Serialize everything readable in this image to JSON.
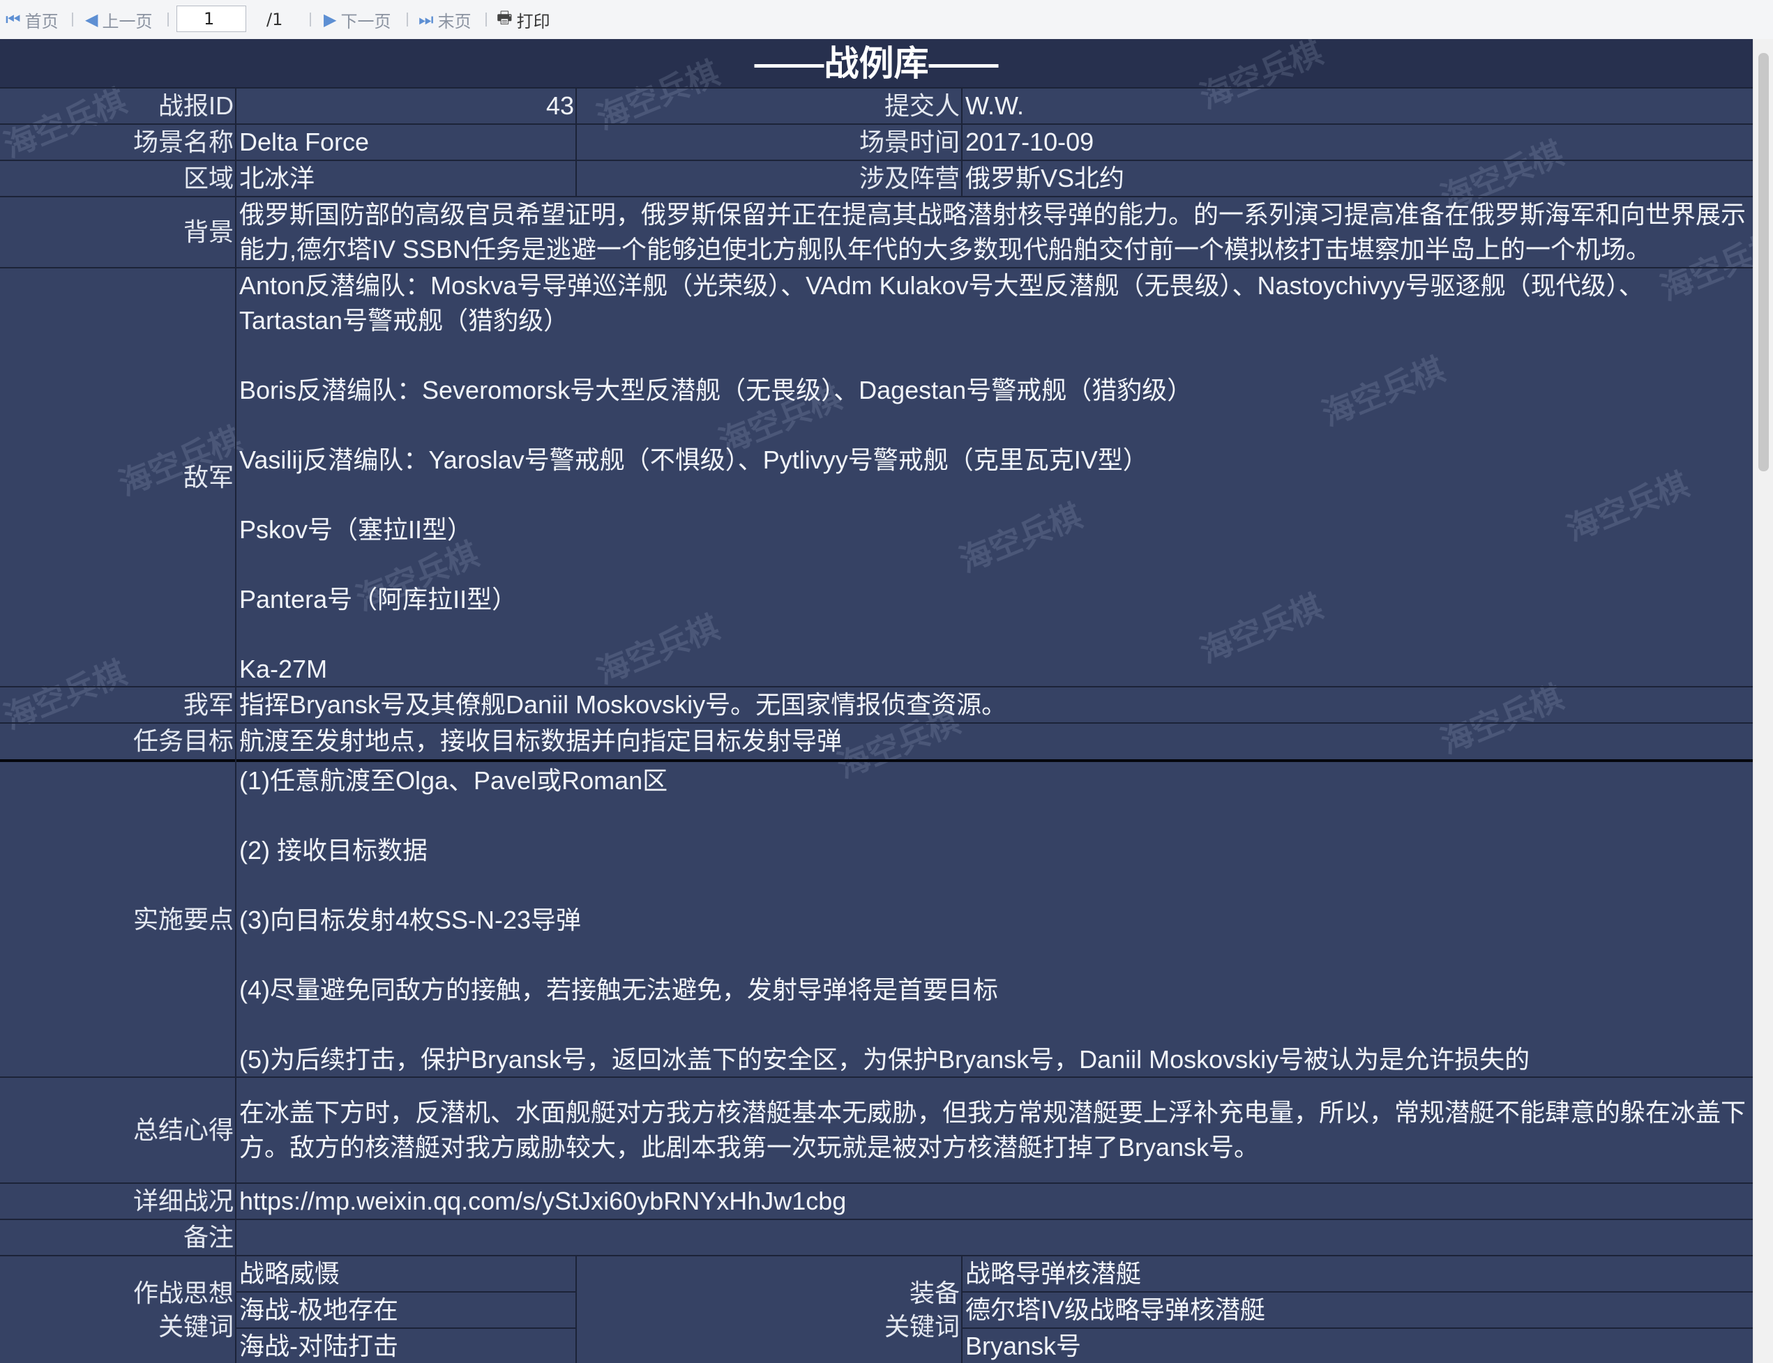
{
  "toolbar": {
    "first": "首页",
    "prev": "上一页",
    "page_value": "1",
    "page_total": "/1",
    "next": "下一页",
    "last": "末页",
    "print": "打印"
  },
  "report": {
    "title": "——战例库——",
    "labels": {
      "id": "战报ID",
      "submitter": "提交人",
      "scene_name": "场景名称",
      "scene_time": "场景时间",
      "region": "区域",
      "camps": "涉及阵营",
      "background": "背景",
      "enemy": "敌军",
      "friendly": "我军",
      "objective": "任务目标",
      "key_points": "实施要点",
      "summary": "总结心得",
      "detail": "详细战况",
      "remarks": "备注",
      "doctrine_1": "作战思想",
      "doctrine_2": "关键词",
      "equipment_1": "装备",
      "equipment_2": "关键词"
    },
    "values": {
      "id": "43",
      "submitter": "W.W.",
      "scene_name": "Delta Force",
      "scene_time": "2017-10-09",
      "region": "北冰洋",
      "camps": "俄罗斯VS北约",
      "background": "俄罗斯国防部的高级官员希望证明，俄罗斯保留并正在提高其战略潜射核导弹的能力。的一系列演习提高准备在俄罗斯海军和向世界展示能力,德尔塔IV SSBN任务是逃避一个能够迫使北方舰队年代的大多数现代船舶交付前一个模拟核打击堪察加半岛上的一个机场。",
      "enemy": [
        "Anton反潜编队：Moskva号导弹巡洋舰（光荣级）、VAdm Kulakov号大型反潜舰（无畏级）、Nastoychivyy号驱逐舰（现代级）、Tartastan号警戒舰（猎豹级）",
        "",
        "Boris反潜编队：Severomorsk号大型反潜舰（无畏级）、Dagestan号警戒舰（猎豹级）",
        "",
        "Vasilij反潜编队：Yaroslav号警戒舰（不惧级）、Pytlivyy号警戒舰（克里瓦克IV型）",
        "",
        "Pskov号（塞拉II型）",
        "",
        "Pantera号（阿库拉II型）",
        "",
        "Ka-27M"
      ],
      "friendly": "指挥Bryansk号及其僚舰Daniil Moskovskiy号。无国家情报侦查资源。",
      "objective": "航渡至发射地点，接收目标数据并向指定目标发射导弹",
      "key_points": [
        "(1)任意航渡至Olga、Pavel或Roman区",
        "",
        "(2) 接收目标数据",
        "",
        "(3)向目标发射4枚SS-N-23导弹",
        "",
        "(4)尽量避免同敌方的接触，若接触无法避免，发射导弹将是首要目标",
        "",
        "(5)为后续打击，保护Bryansk号，返回冰盖下的安全区，为保护Bryansk号，Daniil Moskovskiy号被认为是允许损失的"
      ],
      "summary": "在冰盖下方时，反潜机、水面舰艇对方我方核潜艇基本无威胁，但我方常规潜艇要上浮补充电量，所以，常规潜艇不能肆意的躲在冰盖下方。敌方的核潜艇对我方威胁较大，此剧本我第一次玩就是被对方核潜艇打掉了Bryansk号。",
      "detail": "https://mp.weixin.qq.com/s/yStJxi60ybRNYxHhJw1cbg",
      "remarks": "",
      "doctrine": [
        "战略威慑",
        "海战-极地存在",
        "海战-对陆打击"
      ],
      "equipment": [
        "战略导弹核潜艇",
        "德尔塔IV级战略导弹核潜艇",
        "Bryansk号"
      ]
    },
    "watermark": "海空兵棋"
  },
  "colors": {
    "report_bg": "#364264",
    "title_band": "#27304e",
    "grid_line": "#1c2338",
    "text": "#f1f4f9",
    "toolbar_bg": "#f4f5f7",
    "toolbar_icon": "#5d8fd3"
  },
  "icons": {
    "first": "skip-to-first-icon",
    "prev": "triangle-left-icon",
    "next": "triangle-right-icon",
    "last": "skip-to-last-icon",
    "print": "printer-icon"
  }
}
